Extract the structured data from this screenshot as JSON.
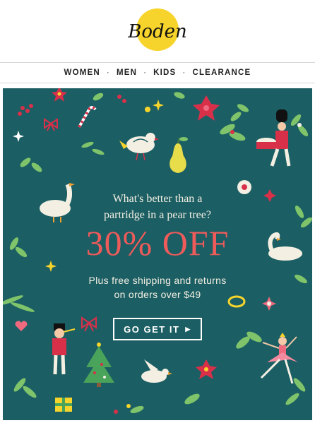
{
  "brand": {
    "logo_text": "Boden"
  },
  "nav": {
    "items": [
      "WOMEN",
      "MEN",
      "KIDS",
      "CLEARANCE"
    ],
    "separator": "·"
  },
  "banner": {
    "headline_line1": "What's better than a",
    "headline_line2": "partridge in a pear tree?",
    "offer": "30% OFF",
    "sub_line1": "Plus free shipping and returns",
    "sub_line2": "on orders over $49",
    "cta_label": "GO GET IT",
    "cta_arrow": "▶"
  },
  "colors": {
    "banner_bg": "#1b5e63",
    "offer_red": "#ee5b5b",
    "logo_yellow": "#f7d42b",
    "cream": "#f3efe3"
  },
  "icons": [
    "partridge-icon",
    "pear-icon",
    "goose-icon",
    "swan-icon",
    "drummer-icon",
    "piper-icon",
    "ballerina-icon",
    "dove-icon",
    "tree-icon",
    "gift-icon",
    "ring-icon",
    "candy-cane-icon",
    "poinsettia-icon",
    "holly-icon",
    "bow-icon"
  ]
}
